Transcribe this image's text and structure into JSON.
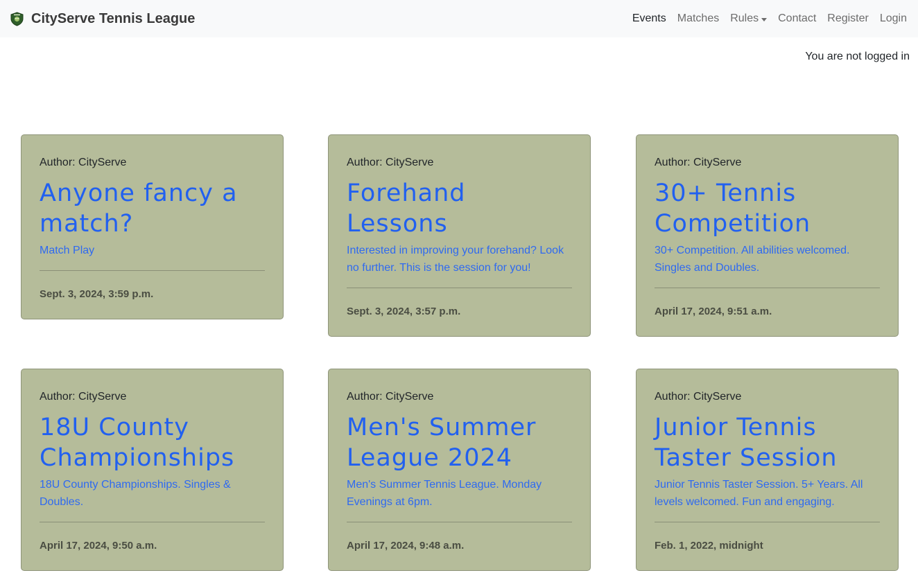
{
  "brand": {
    "name": "CityServe Tennis League",
    "logo_icon": "tennis-shield-icon"
  },
  "nav": {
    "events": "Events",
    "matches": "Matches",
    "rules": "Rules",
    "contact": "Contact",
    "register": "Register",
    "login": "Login"
  },
  "status": {
    "login_text": "You are not logged in"
  },
  "colors": {
    "card_bg": "#b5bc9a",
    "title_link": "#2160f0",
    "navbar_bg": "#f8f9fa"
  },
  "events": [
    {
      "author": "Author: CityServe",
      "title": "Anyone fancy a match?",
      "description": "Match Play",
      "date": "Sept. 3, 2024, 3:59 p.m."
    },
    {
      "author": "Author: CityServe",
      "title": "Forehand Lessons",
      "description": "Interested in improving your forehand? Look no further. This is the session for you!",
      "date": "Sept. 3, 2024, 3:57 p.m."
    },
    {
      "author": "Author: CityServe",
      "title": "30+ Tennis Competition",
      "description": "30+ Competition. All abilities welcomed. Singles and Doubles.",
      "date": "April 17, 2024, 9:51 a.m."
    },
    {
      "author": "Author: CityServe",
      "title": "18U County Championships",
      "description": "18U County Championships. Singles & Doubles.",
      "date": "April 17, 2024, 9:50 a.m."
    },
    {
      "author": "Author: CityServe",
      "title": "Men's Summer League 2024",
      "description": "Men's Summer Tennis League. Monday Evenings at 6pm.",
      "date": "April 17, 2024, 9:48 a.m."
    },
    {
      "author": "Author: CityServe",
      "title": "Junior Tennis Taster Session",
      "description": "Junior Tennis Taster Session. 5+ Years. All levels welcomed. Fun and engaging.",
      "date": "Feb. 1, 2022, midnight"
    }
  ]
}
